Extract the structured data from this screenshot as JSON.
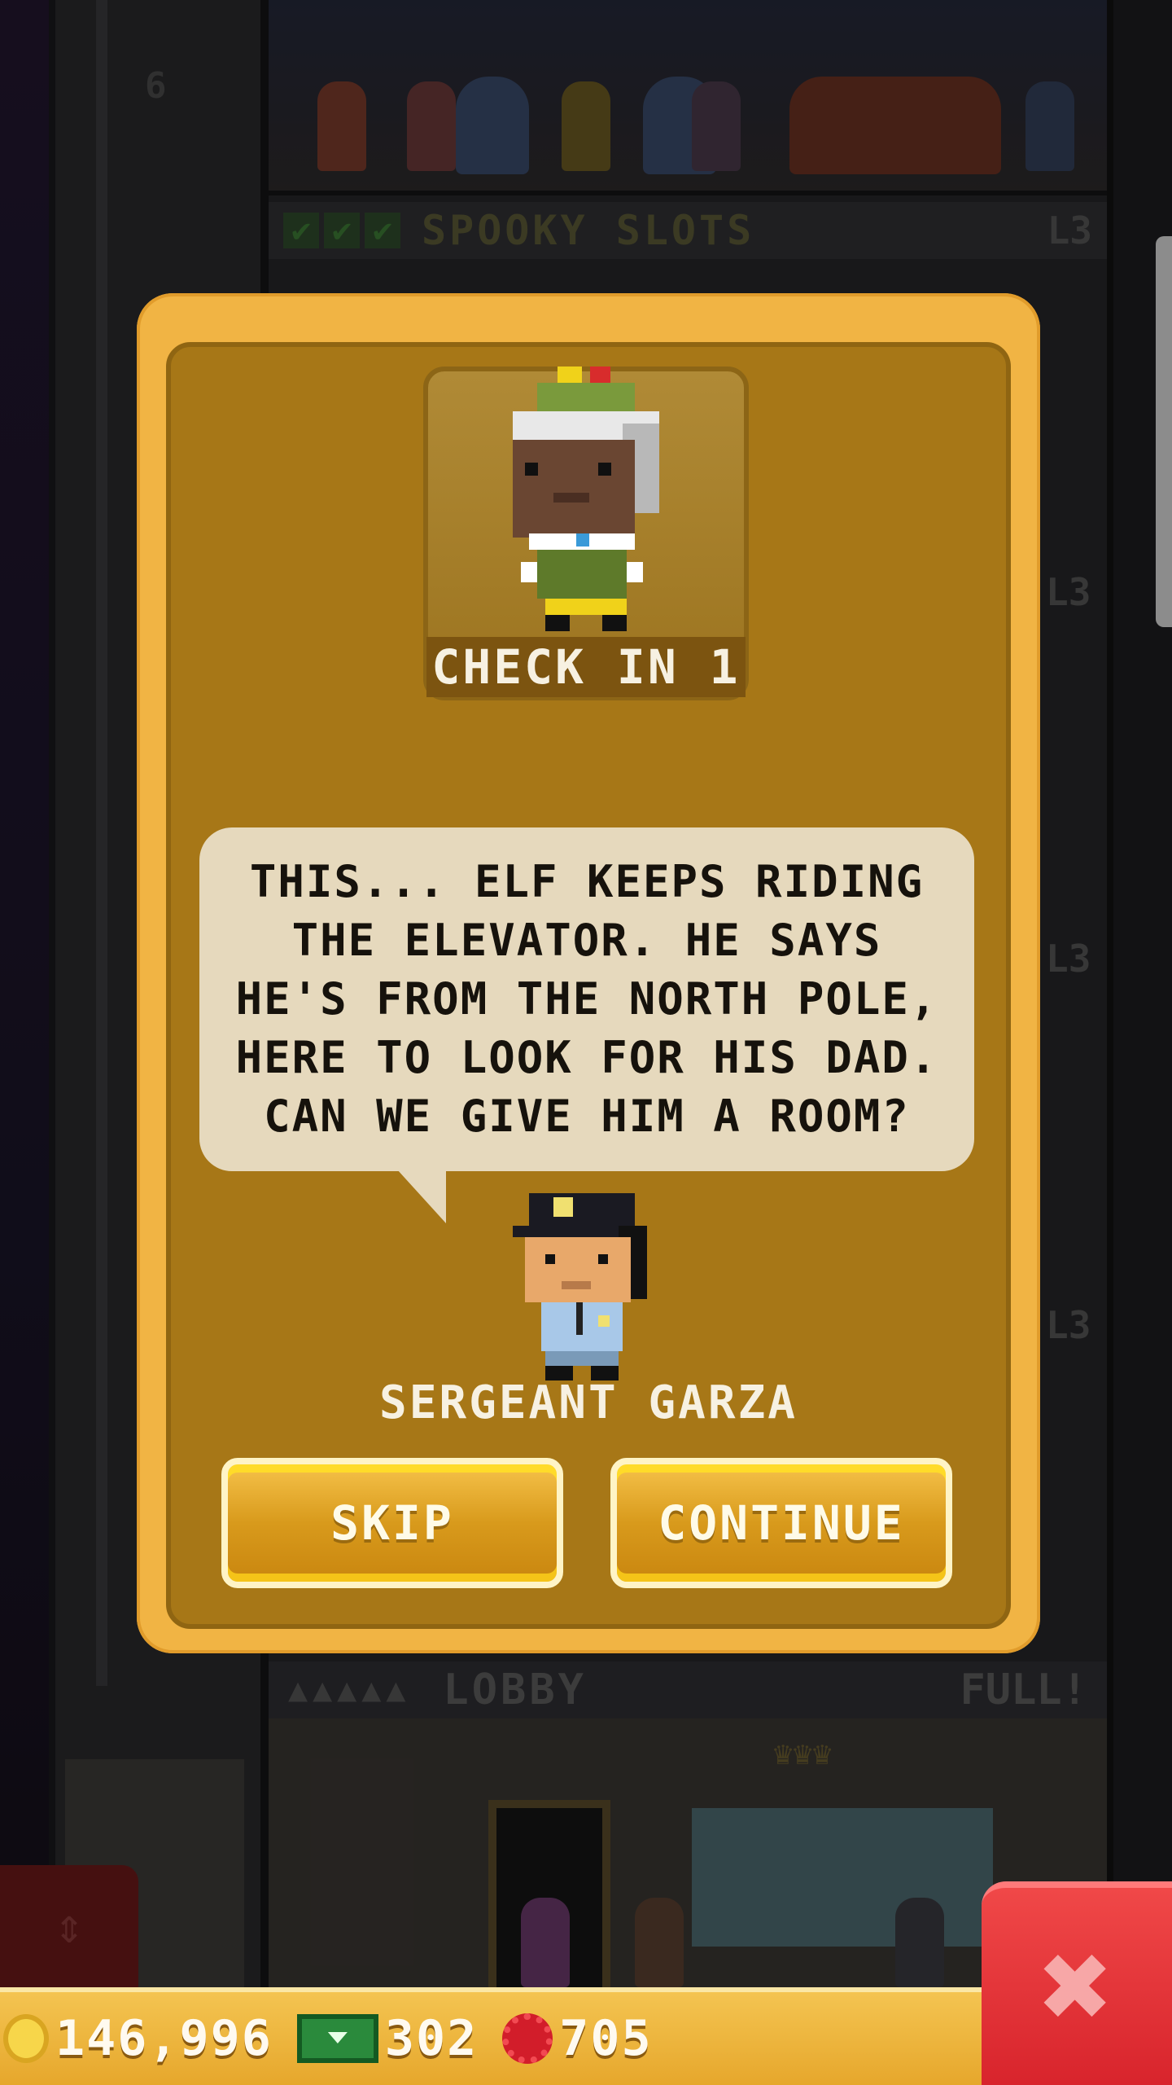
{
  "tower": {
    "elevator_floor_number": "6",
    "top_floor": {
      "name": "SPOOKY SLOTS",
      "level": "L3",
      "stock_checks": [
        "✔",
        "✔",
        "✔"
      ]
    },
    "side_levels": [
      "L3",
      "L3",
      "L3"
    ],
    "lobby": {
      "name": "LOBBY",
      "status": "FULL!",
      "occupancy_dots": "▲▲▲▲▲"
    },
    "elevator_control_icon": "updown-arrows-icon"
  },
  "event": {
    "guest_label": "CHECK IN 1",
    "message": "THIS... ELF KEEPS RIDING THE ELEVATOR. HE SAYS HE'S FROM THE NORTH POLE, HERE TO LOOK FOR HIS DAD. CAN WE GIVE HIM A ROOM?",
    "npc_name": "SERGEANT GARZA",
    "skip_label": "SKIP",
    "continue_label": "CONTINUE"
  },
  "status_bar": {
    "coins": "146,996",
    "bux": "302",
    "gems": "705"
  },
  "close_label": "✖",
  "colors": {
    "dialog_outer": "#f1b444",
    "dialog_inner": "#a77717",
    "speech_bubble": "#e6d9bd",
    "close_button": "#e23a3f",
    "status_bar": "#f4c451"
  }
}
